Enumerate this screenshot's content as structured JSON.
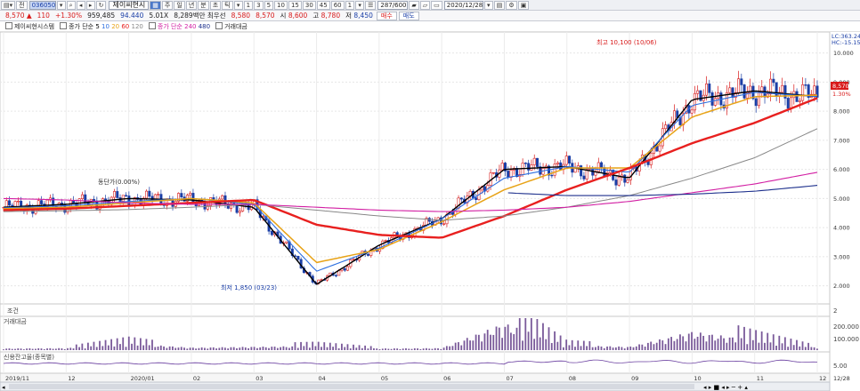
{
  "toolbar": {
    "code": "036050",
    "code_prefix": "전",
    "name": "제이씨현시",
    "icon_buttons": [
      "주",
      "일",
      "년",
      "분",
      "초",
      "틱"
    ],
    "period_buttons": [
      "1",
      "3",
      "5",
      "10",
      "15",
      "30",
      "45",
      "60",
      "1"
    ],
    "count": "287/600",
    "date": "2020/12/28"
  },
  "quote": {
    "price": "8,570",
    "change": "110",
    "change_pct": "+1.30%",
    "volume": "959,485",
    "value": "94.440",
    "ratio": "5.01X",
    "amount": "8,289백만",
    "tag": "최우선",
    "bid": "8,580",
    "ask": "8,570",
    "open_label": "시",
    "open": "8,600",
    "high_label": "고",
    "high": "8,780",
    "low_label": "저",
    "low": "8,450",
    "buy_label": "매수",
    "sell_label": "매도"
  },
  "legend": {
    "name": "제이씨현시스템",
    "ma_label": "종가 단순",
    "ma_periods": [
      "5",
      "10",
      "20",
      "60",
      "120"
    ],
    "ma2_label": "종가 단순",
    "ma2_periods": [
      "240",
      "480"
    ],
    "volume_label": "거래대금"
  },
  "price_axis": [
    "10.000",
    "9.000",
    "8.000",
    "7.000",
    "6.000",
    "5.000",
    "4.000",
    "3.000",
    "2.000"
  ],
  "price_readout": [
    "8,570",
    "1.30%"
  ],
  "corner_readout": [
    "LC:363.24",
    "HC:-15.15"
  ],
  "annotations": {
    "high": "최고 10,100 (10/06)",
    "low": "최저 1,850 (03/23)",
    "halt": "동단가(0.00%)"
  },
  "volume_pane": {
    "label": "거래대금",
    "axis": [
      "200.000",
      "100.000"
    ]
  },
  "credit_pane": {
    "label": "신용잔고율(종목별)",
    "axis": [
      "5.00"
    ]
  },
  "x_axis": [
    "2019/11",
    "12",
    "2020/01",
    "02",
    "03",
    "04",
    "05",
    "06",
    "07",
    "08",
    "09",
    "10",
    "11",
    "12",
    "12/28"
  ],
  "mini_pane_label": "조건",
  "mini_pane_axis": "2",
  "colors": {
    "up": "#d81a1a",
    "down": "#1a3ea6",
    "ma5": "#000000",
    "ma10": "#2d6fe0",
    "ma20": "#e8a317",
    "ma60": "#e8201f",
    "ma120": "#888888",
    "ma240": "#d21fa3",
    "ma480": "#1c2f8c"
  },
  "chart_data": {
    "type": "candlestick",
    "xlabel": "",
    "ylabel": "",
    "ylim": [
      1500,
      10600
    ],
    "x": [
      "2019/11",
      "12",
      "2020/01",
      "02",
      "03",
      "04",
      "05",
      "06",
      "07",
      "08",
      "09",
      "10",
      "11",
      "12"
    ],
    "series": [
      {
        "name": "5",
        "values": [
          4700,
          4800,
          5000,
          4950,
          4700,
          2050,
          3400,
          4300,
          6000,
          6100,
          5700,
          8400,
          8700,
          8500
        ]
      },
      {
        "name": "10",
        "values": [
          4680,
          4750,
          4900,
          5000,
          4800,
          2500,
          3300,
          4300,
          5700,
          6100,
          5900,
          8200,
          8650,
          8500
        ]
      },
      {
        "name": "20",
        "values": [
          4650,
          4700,
          4850,
          5000,
          4850,
          2800,
          3250,
          4200,
          5300,
          6050,
          6050,
          7800,
          8500,
          8550
        ]
      },
      {
        "name": "60",
        "values": [
          4600,
          4650,
          4750,
          4850,
          4950,
          4100,
          3750,
          3650,
          4400,
          5300,
          6050,
          6900,
          7600,
          8450
        ]
      },
      {
        "name": "120",
        "values": [
          4550,
          4580,
          4620,
          4700,
          4800,
          4600,
          4400,
          4250,
          4400,
          4700,
          5100,
          5700,
          6400,
          7400
        ]
      },
      {
        "name": "240",
        "values": [
          5000,
          4950,
          4850,
          4800,
          4800,
          4700,
          4600,
          4550,
          4600,
          4700,
          4900,
          5200,
          5500,
          5900
        ]
      },
      {
        "name": "480",
        "values": [
          null,
          null,
          null,
          null,
          null,
          null,
          null,
          null,
          5200,
          5100,
          5100,
          5150,
          5250,
          5450
        ]
      }
    ],
    "volume": [
      10,
      12,
      40,
      15,
      20,
      25,
      10,
      12,
      160,
      30,
      20,
      110,
      60,
      15
    ]
  }
}
